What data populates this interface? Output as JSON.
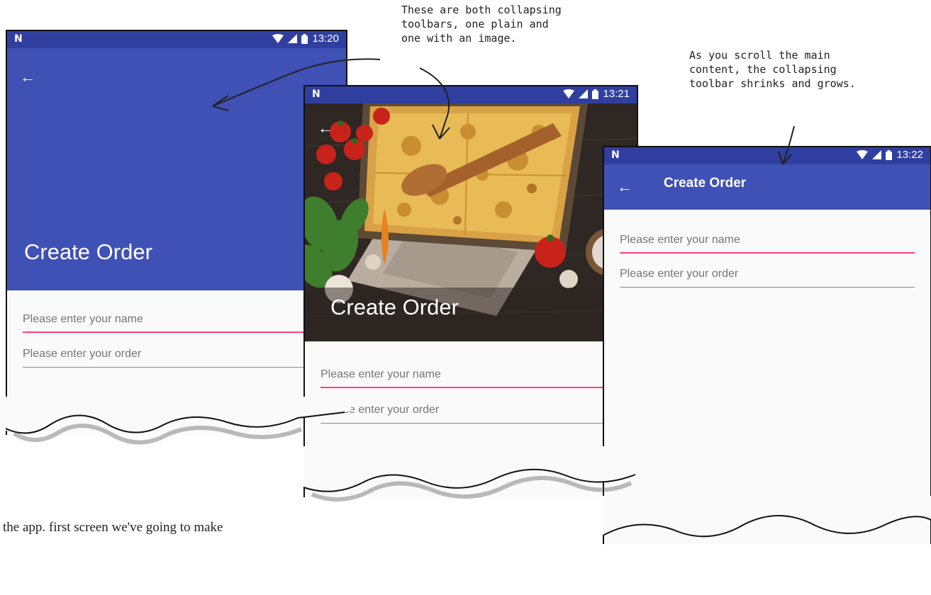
{
  "annotations": {
    "toolbars_note": [
      "These are both collapsing",
      "toolbars, one plain and",
      "one with an image."
    ],
    "scroll_note": [
      "As you scroll the main",
      "content, the collapsing",
      "toolbar shrinks and grows."
    ]
  },
  "screens": [
    {
      "status": {
        "logo": "N",
        "time": "13:20"
      },
      "title": "Create Order",
      "name_placeholder": "Please enter your name",
      "order_placeholder": "Please enter your order"
    },
    {
      "status": {
        "logo": "N",
        "time": "13:21"
      },
      "title": "Create Order",
      "name_placeholder": "Please enter your name",
      "order_placeholder": "Please enter your order"
    },
    {
      "status": {
        "logo": "N",
        "time": "13:22"
      },
      "title": "Create Order",
      "name_placeholder": "Please enter your name",
      "order_placeholder": "Please enter your order"
    }
  ],
  "icons": {
    "back": "arrow-back-icon",
    "wifi": "wifi-icon",
    "signal": "signal-icon",
    "battery": "battery-icon"
  },
  "colors": {
    "toolbar": "#3f51b5",
    "status_bar": "#303f9f",
    "accent": "#ff4081"
  },
  "caption": "the app. first screen we've going to make"
}
